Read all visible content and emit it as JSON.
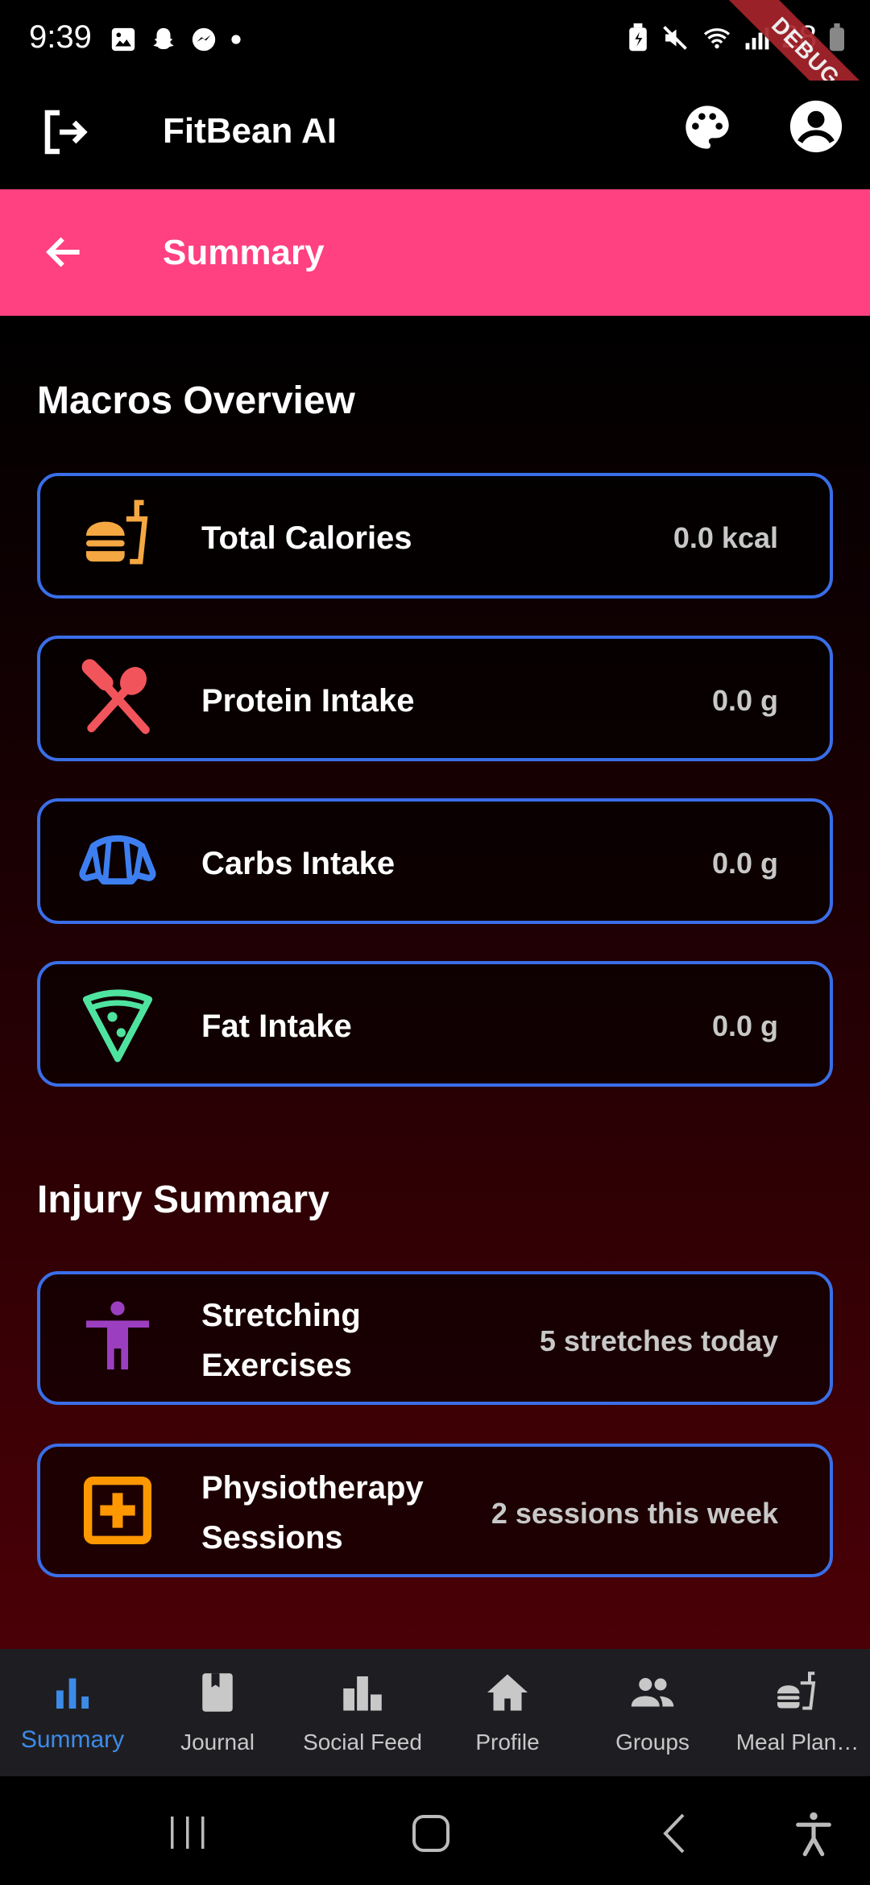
{
  "status_bar": {
    "time": "9:39",
    "battery": "28",
    "debug_label": "DEBUG"
  },
  "app_bar": {
    "title": "FitBean AI"
  },
  "header": {
    "title": "Summary"
  },
  "macros": {
    "title": "Macros Overview",
    "items": [
      {
        "label": "Total Calories",
        "value": "0.0 kcal",
        "icon": "fastfood-icon",
        "color": "#f5a742"
      },
      {
        "label": "Protein Intake",
        "value": "0.0 g",
        "icon": "restaurant-icon",
        "color": "#f2545b"
      },
      {
        "label": "Carbs Intake",
        "value": "0.0 g",
        "icon": "croissant-icon",
        "color": "#3d7ff0"
      },
      {
        "label": "Fat Intake",
        "value": "0.0 g",
        "icon": "pizza-icon",
        "color": "#4fe3a0"
      }
    ]
  },
  "injury": {
    "title": "Injury Summary",
    "items": [
      {
        "label_line1": "Stretching",
        "label_line2": "Exercises",
        "value": "5 stretches today",
        "icon": "accessibility-icon",
        "color": "#9b3fc0"
      },
      {
        "label_line1": "Physiotherapy",
        "label_line2": "Sessions",
        "value": "2 sessions this week",
        "icon": "medical-plus-icon",
        "color": "#ff9800"
      }
    ]
  },
  "bottom_nav": {
    "items": [
      {
        "label": "Summary",
        "icon": "bar-chart-icon",
        "active": true
      },
      {
        "label": "Journal",
        "icon": "book-icon"
      },
      {
        "label": "Social Feed",
        "icon": "leaderboard-icon"
      },
      {
        "label": "Profile",
        "icon": "home-icon"
      },
      {
        "label": "Groups",
        "icon": "people-icon"
      },
      {
        "label": "Meal Plan…",
        "icon": "fastfood-icon"
      }
    ]
  },
  "colors": {
    "accent": "#ff4081",
    "card_border": "#3a6ee8",
    "nav_active": "#3d8be8"
  }
}
